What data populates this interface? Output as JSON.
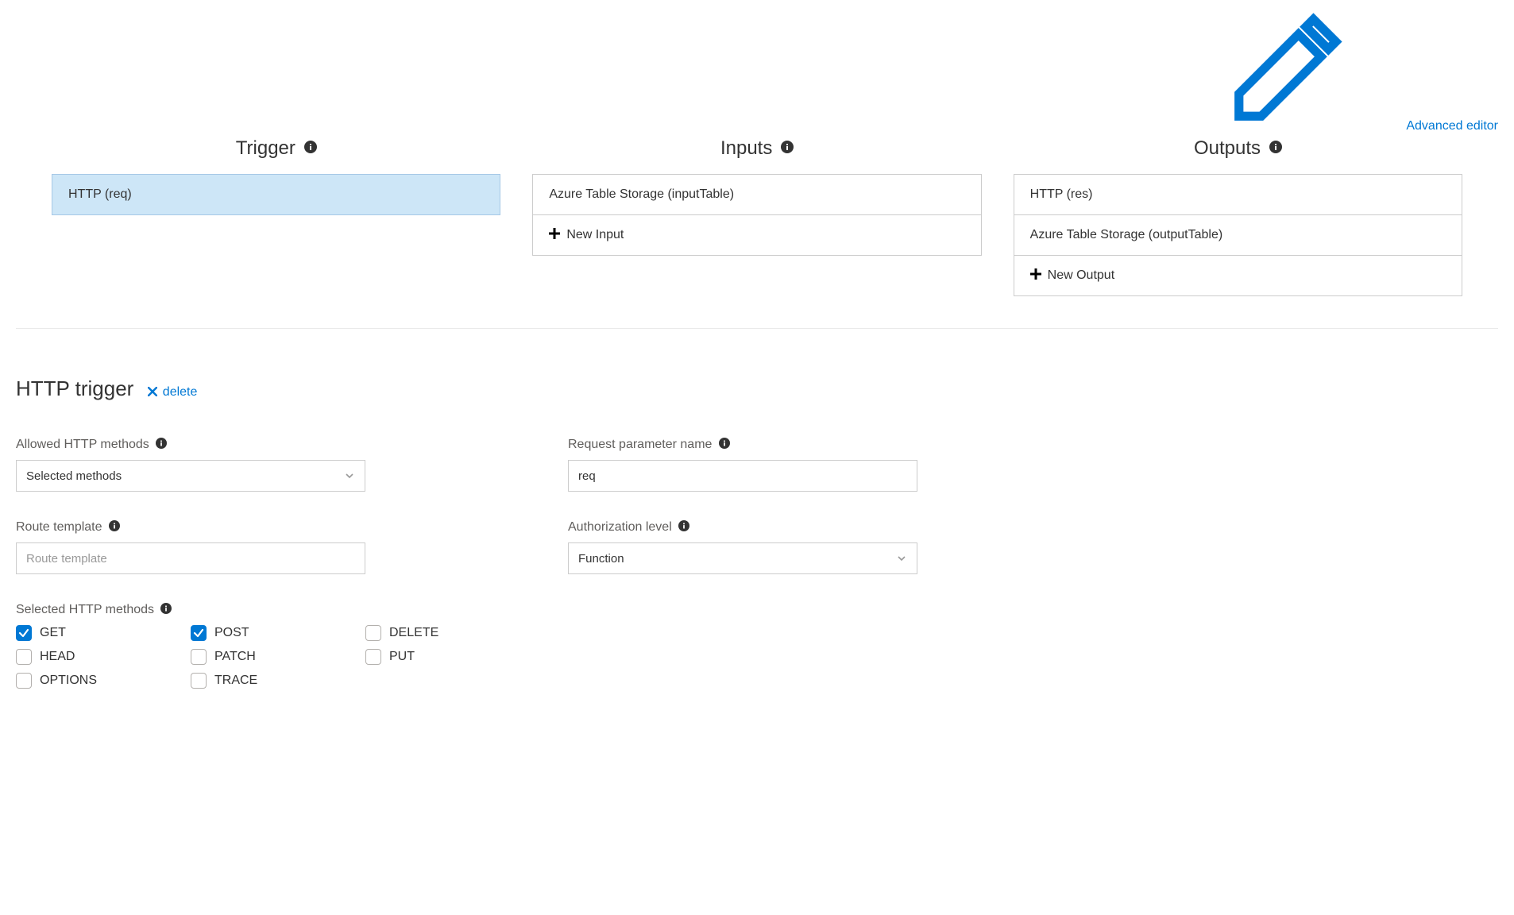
{
  "advancedEditor": "Advanced editor",
  "columns": {
    "trigger": {
      "header": "Trigger",
      "items": [
        "HTTP (req)"
      ]
    },
    "inputs": {
      "header": "Inputs",
      "items": [
        "Azure Table Storage (inputTable)"
      ],
      "addLabel": "New Input"
    },
    "outputs": {
      "header": "Outputs",
      "items": [
        "HTTP (res)",
        "Azure Table Storage (outputTable)"
      ],
      "addLabel": "New Output"
    }
  },
  "detail": {
    "title": "HTTP trigger",
    "deleteLabel": "delete",
    "allowedMethods": {
      "label": "Allowed HTTP methods",
      "value": "Selected methods"
    },
    "requestParam": {
      "label": "Request parameter name",
      "value": "req"
    },
    "routeTemplate": {
      "label": "Route template",
      "placeholder": "Route template",
      "value": ""
    },
    "authLevel": {
      "label": "Authorization level",
      "value": "Function"
    },
    "selectedMethods": {
      "label": "Selected HTTP methods",
      "options": [
        {
          "label": "GET",
          "checked": true
        },
        {
          "label": "POST",
          "checked": true
        },
        {
          "label": "DELETE",
          "checked": false
        },
        {
          "label": "HEAD",
          "checked": false
        },
        {
          "label": "PATCH",
          "checked": false
        },
        {
          "label": "PUT",
          "checked": false
        },
        {
          "label": "OPTIONS",
          "checked": false
        },
        {
          "label": "TRACE",
          "checked": false
        }
      ]
    }
  }
}
